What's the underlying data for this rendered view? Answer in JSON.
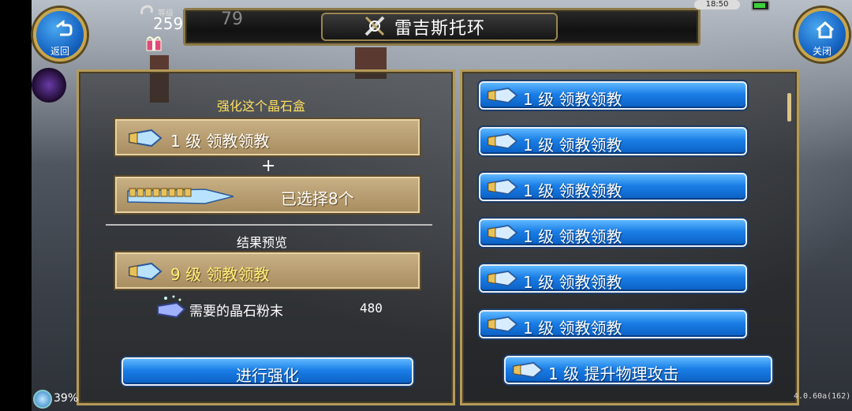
{
  "window": {
    "title": "雷吉斯托环"
  },
  "top_left": {
    "back_label": "返回",
    "level_label": "等级",
    "level_value": "259",
    "hidden_num": "79"
  },
  "top_right": {
    "close_label": "关闭",
    "time": "18:50"
  },
  "left_panel": {
    "enhance_title": "强化这个晶石盒",
    "base_item": "1 级  领教领教",
    "plus": "+",
    "selected_text": "已选择8个",
    "preview_title": "结果预览",
    "result_item": "9 级  领教领教",
    "required_label": "需要的晶石粉末",
    "required_value": "480",
    "enhance_button": "进行强化"
  },
  "right_list": {
    "items": [
      {
        "label": "1  级  领教领教"
      },
      {
        "label": "1  级  领教领教"
      },
      {
        "label": "1  级  领教领教"
      },
      {
        "label": "1  级  领教领教"
      },
      {
        "label": "1  级  领教领教"
      },
      {
        "label": "1  级  领教领教"
      },
      {
        "label": "1  级  提升物理攻击"
      }
    ]
  },
  "bottom": {
    "percent": "39%",
    "version": "4.0.60a(162)"
  },
  "colors": {
    "accent_blue": "#1a7ee6",
    "gold_frame": "#b49a5a",
    "title_yellow": "#ffe060"
  }
}
